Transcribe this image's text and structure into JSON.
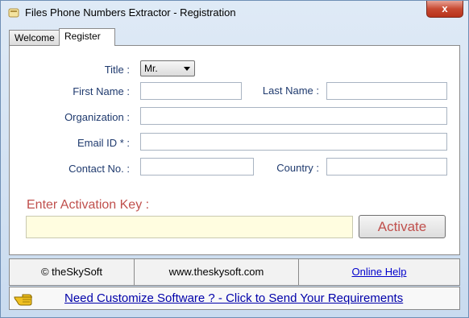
{
  "window": {
    "title": "Files Phone Numbers Extractor  - Registration",
    "close_label": "x"
  },
  "tabs": [
    {
      "label": "Welcome",
      "active": false
    },
    {
      "label": "Register",
      "active": true
    }
  ],
  "form": {
    "title_label": "Title :",
    "title_value": "Mr.",
    "first_name_label": "First Name :",
    "first_name_value": "",
    "last_name_label": "Last Name :",
    "last_name_value": "",
    "organization_label": "Organization :",
    "organization_value": "",
    "email_label": "Email ID * :",
    "email_value": "",
    "contact_label": "Contact No. :",
    "contact_value": "",
    "country_label": "Country :",
    "country_value": ""
  },
  "activation": {
    "label": "Enter Activation Key  :",
    "value": "",
    "button_label": "Activate"
  },
  "footer": {
    "copyright": "©  theSkySoft",
    "website": "www.theskysoft.com",
    "help_link": "Online Help"
  },
  "banner": {
    "link_text": "Need Customize Software ? - Click to Send Your Requirements"
  },
  "colors": {
    "accent_red": "#c0504d",
    "link_blue": "#0000cc",
    "label_blue": "#1f3a6e",
    "activation_bg": "#fffde0"
  }
}
